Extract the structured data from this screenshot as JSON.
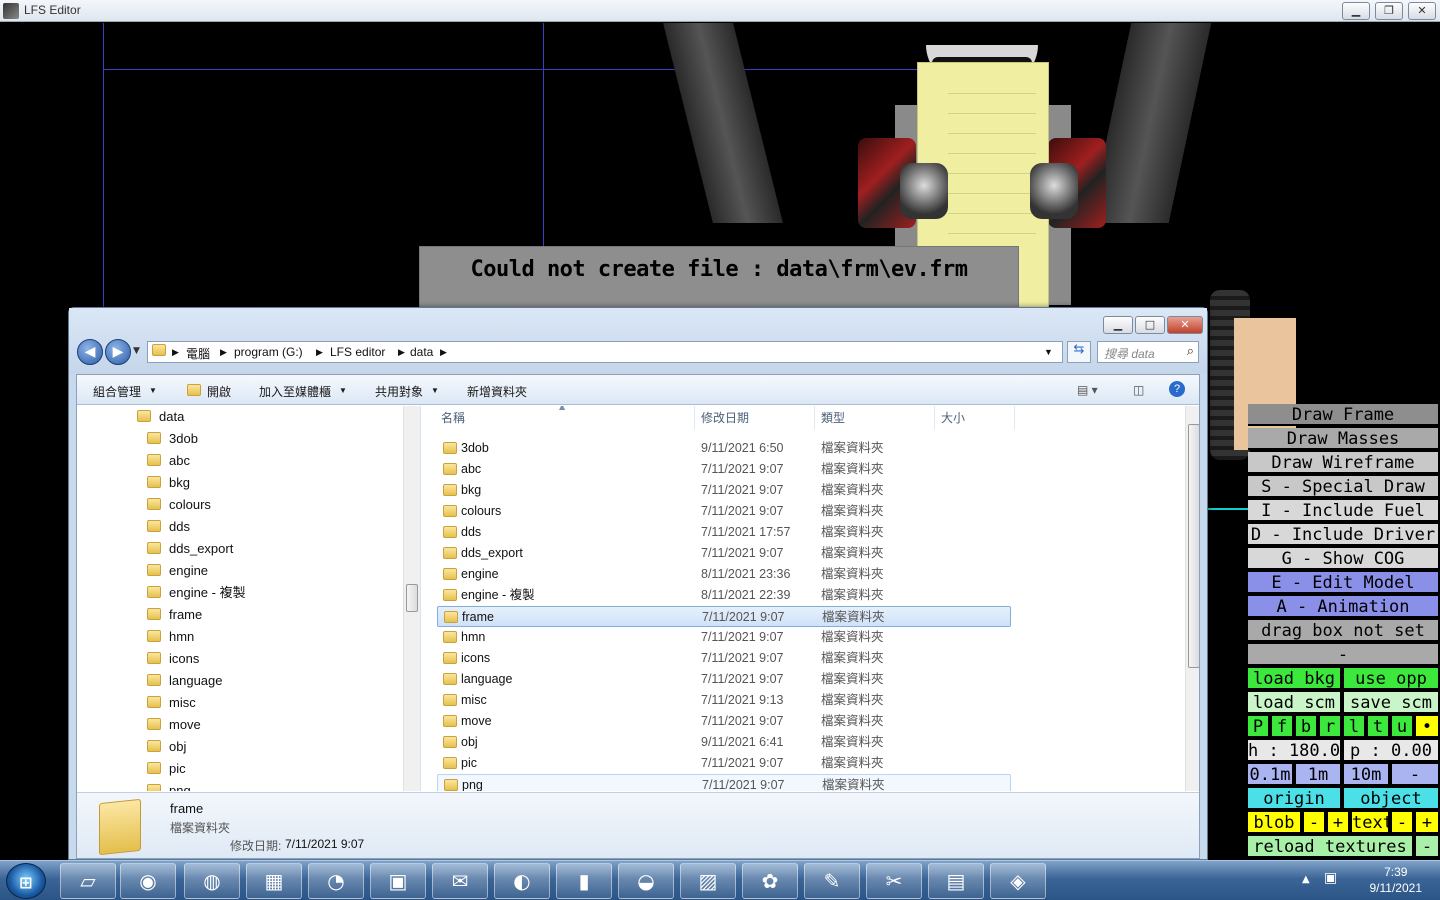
{
  "lfs": {
    "title": "LFS Editor",
    "error_message": "Could not create file : data\\frm\\ev.frm",
    "panel": {
      "draw_frame": "Draw Frame",
      "draw_masses": "Draw Masses",
      "draw_wireframe": "Draw Wireframe",
      "special_draw": "S - Special Draw",
      "include_fuel": "I - Include Fuel",
      "include_driver": "D - Include Driver",
      "show_cog": "G - Show COG",
      "edit_model": "E - Edit Model",
      "animation": "A - Animation",
      "drag_box": "drag box not set",
      "dash": "-",
      "load_bkg": "load bkg",
      "use_opp": "use opp",
      "load_scm": "load scm",
      "save_scm": "save scm",
      "toggles": [
        "P",
        "f",
        "b",
        "r",
        "l",
        "t",
        "u",
        "•"
      ],
      "heading": "h : 180.00",
      "pitch": "p : 0.00",
      "steps": [
        "0.1m",
        "1m",
        "10m",
        "-"
      ],
      "origin": "origin",
      "object": "object",
      "blob": "blob",
      "text": "text",
      "minus": "-",
      "plus": "+",
      "reload_textures": "reload textures"
    }
  },
  "explorer": {
    "breadcrumb": [
      "電腦",
      "program (G:)",
      "LFS editor",
      "data"
    ],
    "search_placeholder": "搜尋 data",
    "toolbar": [
      "組合管理",
      "開啟",
      "加入至媒體櫃",
      "共用對象",
      "新增資料夾"
    ],
    "tree_root": "data",
    "tree_items": [
      "3dob",
      "abc",
      "bkg",
      "colours",
      "dds",
      "dds_export",
      "engine",
      "engine - 複製",
      "frame",
      "hmn",
      "icons",
      "language",
      "misc",
      "move",
      "obj",
      "pic",
      "png"
    ],
    "columns": [
      "名稱",
      "修改日期",
      "類型",
      "大小"
    ],
    "files": [
      {
        "name": "3dob",
        "date": "9/11/2021 6:50",
        "type": "檔案資料夾"
      },
      {
        "name": "abc",
        "date": "7/11/2021 9:07",
        "type": "檔案資料夾"
      },
      {
        "name": "bkg",
        "date": "7/11/2021 9:07",
        "type": "檔案資料夾"
      },
      {
        "name": "colours",
        "date": "7/11/2021 9:07",
        "type": "檔案資料夾"
      },
      {
        "name": "dds",
        "date": "7/11/2021 17:57",
        "type": "檔案資料夾"
      },
      {
        "name": "dds_export",
        "date": "7/11/2021 9:07",
        "type": "檔案資料夾"
      },
      {
        "name": "engine",
        "date": "8/11/2021 23:36",
        "type": "檔案資料夾"
      },
      {
        "name": "engine - 複製",
        "date": "8/11/2021 22:39",
        "type": "檔案資料夾"
      },
      {
        "name": "frame",
        "date": "7/11/2021 9:07",
        "type": "檔案資料夾"
      },
      {
        "name": "hmn",
        "date": "7/11/2021 9:07",
        "type": "檔案資料夾"
      },
      {
        "name": "icons",
        "date": "7/11/2021 9:07",
        "type": "檔案資料夾"
      },
      {
        "name": "language",
        "date": "7/11/2021 9:07",
        "type": "檔案資料夾"
      },
      {
        "name": "misc",
        "date": "7/11/2021 9:13",
        "type": "檔案資料夾"
      },
      {
        "name": "move",
        "date": "7/11/2021 9:07",
        "type": "檔案資料夾"
      },
      {
        "name": "obj",
        "date": "9/11/2021 6:41",
        "type": "檔案資料夾"
      },
      {
        "name": "pic",
        "date": "7/11/2021 9:07",
        "type": "檔案資料夾"
      },
      {
        "name": "png",
        "date": "7/11/2021 9:07",
        "type": "檔案資料夾"
      }
    ],
    "selected_index": 8,
    "hover_index": 16,
    "details": {
      "name": "frame",
      "type": "檔案資料夾",
      "modified_label": "修改日期:",
      "modified_value": "7/11/2021 9:07"
    }
  },
  "taskbar": {
    "time": "7:39",
    "date": "9/11/2021"
  }
}
